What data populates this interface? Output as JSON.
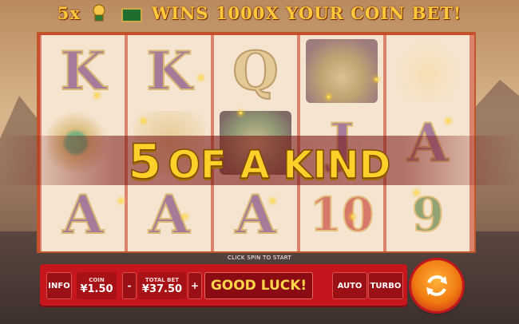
{
  "headline": {
    "prefix": "5x",
    "suffix": "WINS 1000X YOUR COIN BET!"
  },
  "win_message": {
    "number": "5",
    "text": "OF A KIND"
  },
  "reels": [
    [
      "K",
      "ring",
      "A"
    ],
    [
      "K",
      "dragon",
      "A"
    ],
    [
      "Q",
      "green-lantern",
      "A"
    ],
    [
      "lantern-scatter",
      "J",
      "10"
    ],
    [
      "coin-tree",
      "A",
      "9"
    ]
  ],
  "hint": "CLICK SPIN TO START",
  "controls": {
    "info_label": "INFO",
    "coin_label": "COIN",
    "coin_value": "¥1.50",
    "minus_label": "-",
    "total_bet_label": "TOTAL BET",
    "total_bet_value": "¥37.50",
    "plus_label": "+",
    "good_luck_label": "GOOD LUCK!",
    "auto_label": "AUTO",
    "turbo_label": "TURBO"
  },
  "colors": {
    "accent": "#c4161c",
    "gold": "#ffd02a",
    "spin": "#f07a10"
  }
}
